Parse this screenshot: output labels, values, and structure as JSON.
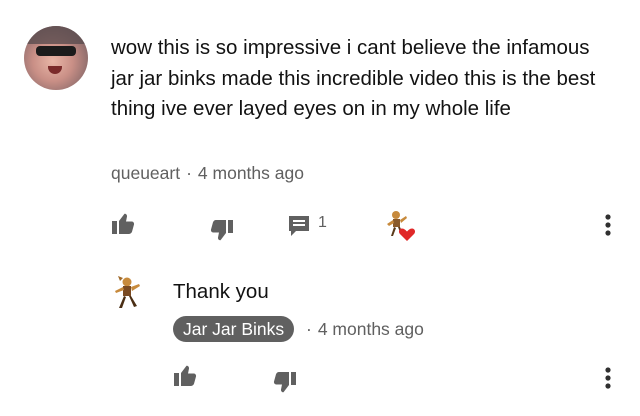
{
  "comment": {
    "text": "wow this is so impressive i cant believe the infamous jar jar binks made this incredible video this is the best thing ive ever layed eyes on in my whole life",
    "author": "queueart",
    "separator": "·",
    "time": "4 months ago",
    "reply_count": "1"
  },
  "reply": {
    "text": "Thank you",
    "author": "Jar Jar Binks",
    "separator": "·",
    "time": "4 months ago"
  },
  "colors": {
    "text_primary": "#121212",
    "text_secondary": "#606060",
    "heart": "#e02828",
    "chip_bg": "#606060"
  }
}
